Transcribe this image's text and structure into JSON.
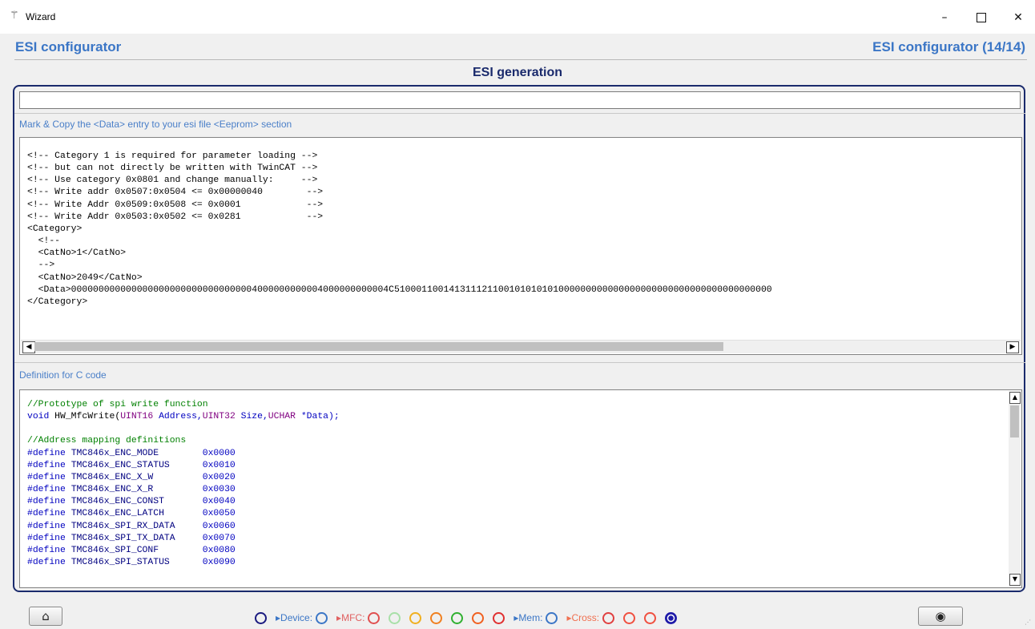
{
  "window": {
    "title": "Wizard",
    "icon": "wand-icon",
    "controls": {
      "minimize": "–",
      "close": "✕"
    }
  },
  "header": {
    "app_title": "ESI configurator",
    "step": "ESI configurator (14/14)",
    "section_title": "ESI generation"
  },
  "top_input": {
    "value": ""
  },
  "esi_section": {
    "label": "Mark & Copy  the <Data> entry to your esi file <Eeprom> section",
    "code": "<!-- Category 1 is required for parameter loading -->\n<!-- but can not directly be written with TwinCAT -->\n<!-- Use category 0x0801 and change manually:     -->\n<!-- Write addr 0x0507:0x0504 <= 0x00000040        -->\n<!-- Write Addr 0x0509:0x0508 <= 0x0001            -->\n<!-- Write Addr 0x0503:0x0502 <= 0x0281            -->\n<Category>\n  <!--\n  <CatNo>1</CatNo>\n  -->\n  <CatNo>2049</CatNo>\n  <Data>0000000000000000000000000000000004000000000004000000000004C510001100141311121100101010101000000000000000000000000000000000000000\n</Category>"
  },
  "c_section": {
    "label": "Definition for C code",
    "proto_comment": "//Prototype of spi write function",
    "proto_void": "void",
    "proto_fn": " HW_MfcWrite(",
    "proto_t1": "UINT16",
    "proto_a1": " Address,",
    "proto_t2": "UINT32",
    "proto_a2": " Size,",
    "proto_t3": "UCHAR",
    "proto_a3": " *Data);",
    "map_comment": "//Address mapping definitions",
    "defines": [
      {
        "kw": "#define",
        "name": " TMC846x_ENC_MODE        ",
        "val": "0x0000"
      },
      {
        "kw": "#define",
        "name": " TMC846x_ENC_STATUS      ",
        "val": "0x0010"
      },
      {
        "kw": "#define",
        "name": " TMC846x_ENC_X_W         ",
        "val": "0x0020"
      },
      {
        "kw": "#define",
        "name": " TMC846x_ENC_X_R         ",
        "val": "0x0030"
      },
      {
        "kw": "#define",
        "name": " TMC846x_ENC_CONST       ",
        "val": "0x0040"
      },
      {
        "kw": "#define",
        "name": " TMC846x_ENC_LATCH       ",
        "val": "0x0050"
      },
      {
        "kw": "#define",
        "name": " TMC846x_SPI_RX_DATA     ",
        "val": "0x0060"
      },
      {
        "kw": "#define",
        "name": " TMC846x_SPI_TX_DATA     ",
        "val": "0x0070"
      },
      {
        "kw": "#define",
        "name": " TMC846x_SPI_CONF        ",
        "val": "0x0080"
      },
      {
        "kw": "#define",
        "name": " TMC846x_SPI_STATUS      ",
        "val": "0x0090"
      }
    ]
  },
  "footer": {
    "home_icon": "home-icon",
    "back_icon": "back-circle-icon",
    "nav": [
      {
        "type": "circle",
        "color": "#1a1a80"
      },
      {
        "type": "label",
        "text": "▸Device:",
        "color": "#3b76c6"
      },
      {
        "type": "circle",
        "color": "#3b76c6"
      },
      {
        "type": "label",
        "text": "▸MFC:",
        "color": "#e06060"
      },
      {
        "type": "circle",
        "color": "#e05050"
      },
      {
        "type": "circle",
        "color": "#a8e0a8"
      },
      {
        "type": "circle",
        "color": "#f0b020"
      },
      {
        "type": "circle",
        "color": "#f08020"
      },
      {
        "type": "circle",
        "color": "#30b030"
      },
      {
        "type": "circle",
        "color": "#f06020"
      },
      {
        "type": "circle",
        "color": "#e03030"
      },
      {
        "type": "label",
        "text": "▸Mem:",
        "color": "#3b76c6"
      },
      {
        "type": "circle",
        "color": "#3b76c6"
      },
      {
        "type": "label",
        "text": "▸Cross:",
        "color": "#f07050"
      },
      {
        "type": "circle",
        "color": "#e04040"
      },
      {
        "type": "circle",
        "color": "#f05040"
      },
      {
        "type": "circle",
        "color": "#f05040"
      },
      {
        "type": "filled",
        "color": "#1e1aa8"
      }
    ]
  }
}
